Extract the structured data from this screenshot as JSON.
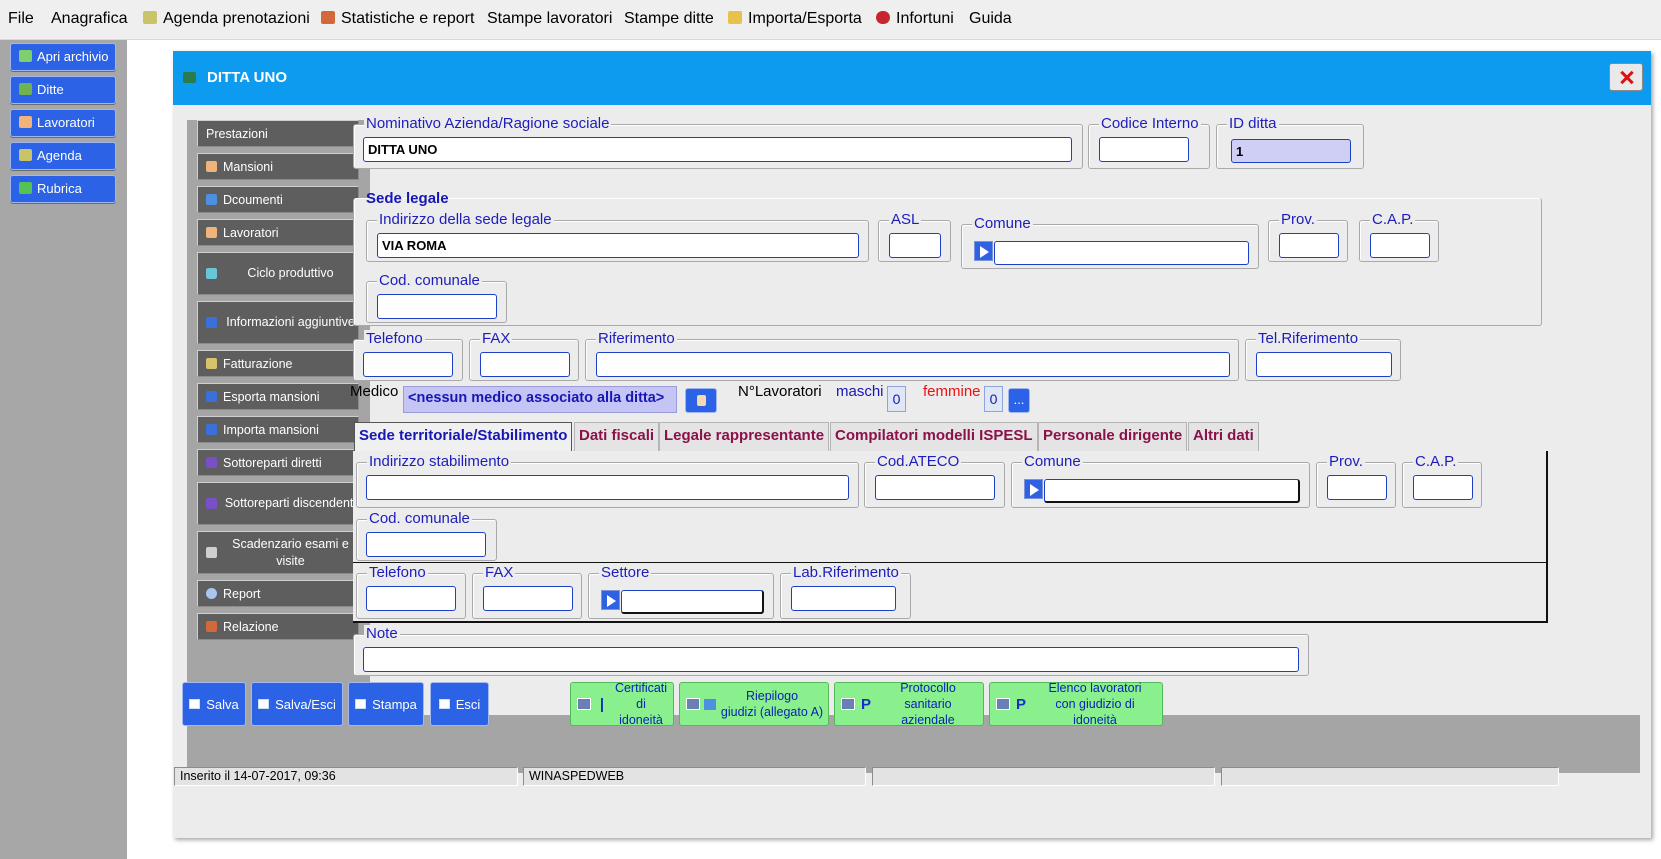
{
  "menu": [
    "File",
    "Anagrafica",
    "Agenda prenotazioni",
    "Statistiche e report",
    "Stampe lavoratori",
    "Stampe ditte",
    "Importa/Esporta",
    "Infortuni",
    "Guida"
  ],
  "sidebar": [
    "Apri archivio",
    "Ditte",
    "Lavoratori",
    "Agenda",
    "Rubrica"
  ],
  "window": {
    "title": "DITTA UNO"
  },
  "nav": [
    "Prestazioni",
    "Mansioni",
    "Dcoumenti",
    "Lavoratori",
    "Ciclo produttivo",
    "Informazioni aggiuntive",
    "Fatturazione",
    "Esporta mansioni",
    "Importa mansioni",
    "Sottoreparti diretti",
    "Sottoreparti discendenti",
    "Scadenzario esami e visite",
    "Report",
    "Relazione"
  ],
  "azienda": {
    "nominativo_label": "Nominativo Azienda/Ragione sociale",
    "nominativo": "DITTA UNO",
    "codice_interno_label": "Codice Interno",
    "codice_interno": "",
    "id_ditta_label": "ID ditta",
    "id_ditta": "1"
  },
  "sede_legale": {
    "title": "Sede legale",
    "indirizzo_label": "Indirizzo della sede legale",
    "indirizzo": "VIA ROMA",
    "asl_label": "ASL",
    "comune_label": "Comune",
    "prov_label": "Prov.",
    "cap_label": "C.A.P.",
    "cod_comunale_label": "Cod. comunale"
  },
  "contatti": {
    "telefono_label": "Telefono",
    "fax_label": "FAX",
    "riferimento_label": "Riferimento",
    "tel_riferimento_label": "Tel.Riferimento"
  },
  "medico": {
    "label": "Medico",
    "value": "<nessun medico associato alla ditta>",
    "n_lavoratori_label": "N°Lavoratori",
    "maschi_label": "maschi",
    "maschi": "0",
    "femmine_label": "femmine",
    "femmine": "0",
    "more_label": "..."
  },
  "tabs": [
    "Sede territoriale/Stabilimento",
    "Dati fiscali",
    "Legale rappresentante",
    "Compilatori modelli ISPESL",
    "Personale dirigente",
    "Altri dati"
  ],
  "stabilimento": {
    "indirizzo_label": "Indirizzo stabilimento",
    "ateco_label": "Cod.ATECO",
    "comune_label": "Comune",
    "prov_label": "Prov.",
    "cap_label": "C.A.P.",
    "cod_comunale_label": "Cod. comunale",
    "telefono_label": "Telefono",
    "fax_label": "FAX",
    "settore_label": "Settore",
    "lab_riferimento_label": "Lab.Riferimento"
  },
  "note_label": "Note",
  "buttons": [
    "Salva",
    "Salva/Esci",
    "Stampa",
    "Esci"
  ],
  "green_buttons": [
    {
      "line1": "Certificati",
      "line2": "di idoneità",
      "pico": ""
    },
    {
      "line1": "Riepilogo",
      "line2": "giudizi (allegato A)",
      "pico": ""
    },
    {
      "line1": "Protocollo",
      "line2": "sanitario aziendale",
      "pico": "P"
    },
    {
      "line1": "Elenco lavoratori",
      "line2": "con giudizio di idoneità",
      "pico": "P"
    }
  ],
  "status": [
    "Inserito il 14-07-2017, 09:36",
    "WINASPEDWEB",
    "",
    ""
  ],
  "colors": {
    "menubar": "#efefef",
    "accent_blue": "#2b62e6",
    "title_blue": "#0c9bef",
    "legend_blue": "#1d1dbd",
    "tab_maroon": "#8a1149",
    "green": "#8af08e"
  }
}
